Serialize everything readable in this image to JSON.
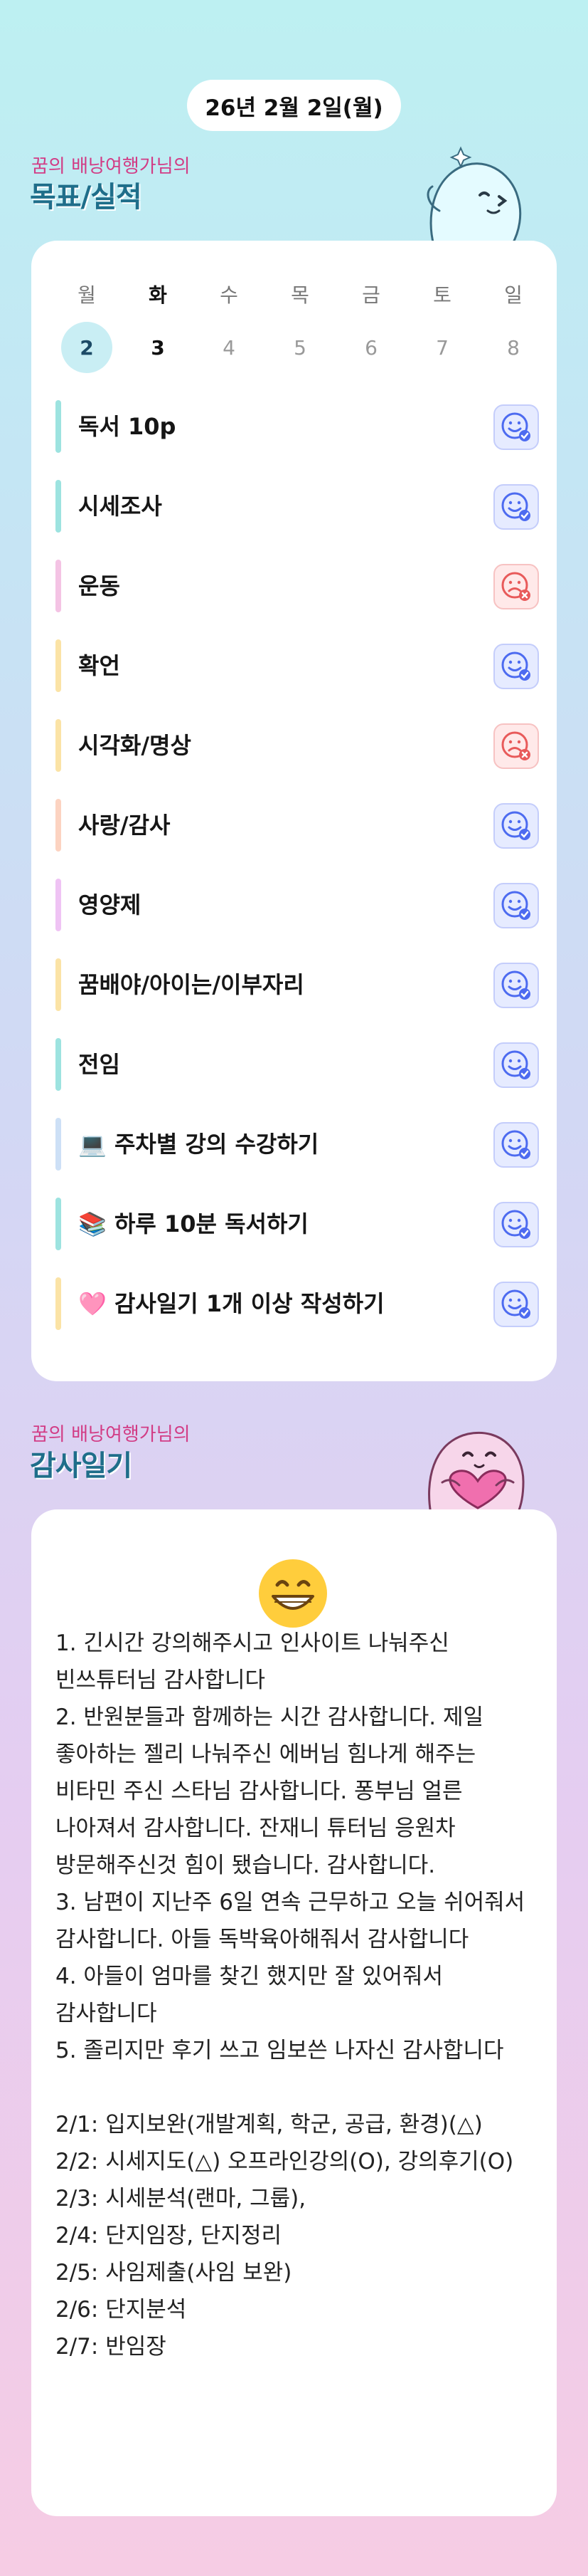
{
  "header": {
    "date": "26년 2월 2일(월)"
  },
  "goals_section": {
    "subtitle": "꿈의 배낭여행가님의",
    "title": "목표/실적"
  },
  "week": {
    "days": [
      {
        "name": "월",
        "num": "2",
        "selected": true,
        "current": false
      },
      {
        "name": "화",
        "num": "3",
        "selected": false,
        "current": true
      },
      {
        "name": "수",
        "num": "4",
        "selected": false,
        "current": false
      },
      {
        "name": "목",
        "num": "5",
        "selected": false,
        "current": false
      },
      {
        "name": "금",
        "num": "6",
        "selected": false,
        "current": false
      },
      {
        "name": "토",
        "num": "7",
        "selected": false,
        "current": false
      },
      {
        "name": "일",
        "num": "8",
        "selected": false,
        "current": false
      }
    ]
  },
  "tasks": [
    {
      "label": "독서 10p",
      "status": "done",
      "bar_color": "#9de3e0"
    },
    {
      "label": "시세조사",
      "status": "done",
      "bar_color": "#9de3e0"
    },
    {
      "label": "운동",
      "status": "fail",
      "bar_color": "#f4c3e4"
    },
    {
      "label": "확언",
      "status": "done",
      "bar_color": "#fbe3a6"
    },
    {
      "label": "시각화/명상",
      "status": "fail",
      "bar_color": "#fbe3a6"
    },
    {
      "label": "사랑/감사",
      "status": "done",
      "bar_color": "#fcd3c1"
    },
    {
      "label": "영양제",
      "status": "done",
      "bar_color": "#efc3f4"
    },
    {
      "label": "꿈배야/아이는/이부자리",
      "status": "done",
      "bar_color": "#fbe3a6"
    },
    {
      "label": "전임",
      "status": "done",
      "bar_color": "#9de3e0"
    },
    {
      "label": "💻 주차별 강의 수강하기",
      "status": "done",
      "bar_color": "#cde0f6"
    },
    {
      "label": "📚 하루 10분 독서하기",
      "status": "done",
      "bar_color": "#9de3e0"
    },
    {
      "label": "🩷 감사일기 1개 이상 작성하기",
      "status": "done",
      "bar_color": "#fbe3a6"
    }
  ],
  "status_icons": {
    "done": "smile-check-icon",
    "fail": "frown-x-icon"
  },
  "colors": {
    "done_icon": "#4d6bf0",
    "fail_icon": "#e85a5a",
    "title": "#1f6e8a",
    "subtitle": "#d23c85"
  },
  "gratitude_section": {
    "subtitle": "꿈의 배낭여행가님의",
    "title": "감사일기"
  },
  "gratitude": {
    "emoji": "grinning-face-icon",
    "text": "1. 긴시간 강의해주시고 인사이트 나눠주신 빈쓰튜터님 감사합니다\n2. 반원분들과 함께하는 시간 감사합니다. 제일 좋아하는 젤리 나눠주신 에버님 힘나게 해주는 비타민 주신 스타님 감사합니다. 퐁부님 얼른 나아져서 감사합니다. 잔재니 튜터님 응원차 방문해주신것 힘이 됐습니다. 감사합니다.\n3. 남편이 지난주 6일 연속 근무하고 오늘 쉬어줘서 감사합니다. 아들 독박육아해줘서 감사합니다\n4. 아들이 엄마를 찾긴 했지만 잘 있어줘서 감사합니다\n5. 졸리지만 후기 쓰고 임보쓴 나자신 감사합니다\n\n2/1: 입지보완(개발계획, 학군, 공급, 환경)(△)\n2/2: 시세지도(△) 오프라인강의(O), 강의후기(O)\n2/3: 시세분석(랜마, 그룹),\n2/4: 단지임장, 단지정리\n2/5: 사임제출(사임 보완)\n2/6: 단지분석\n2/7: 반임장"
  }
}
